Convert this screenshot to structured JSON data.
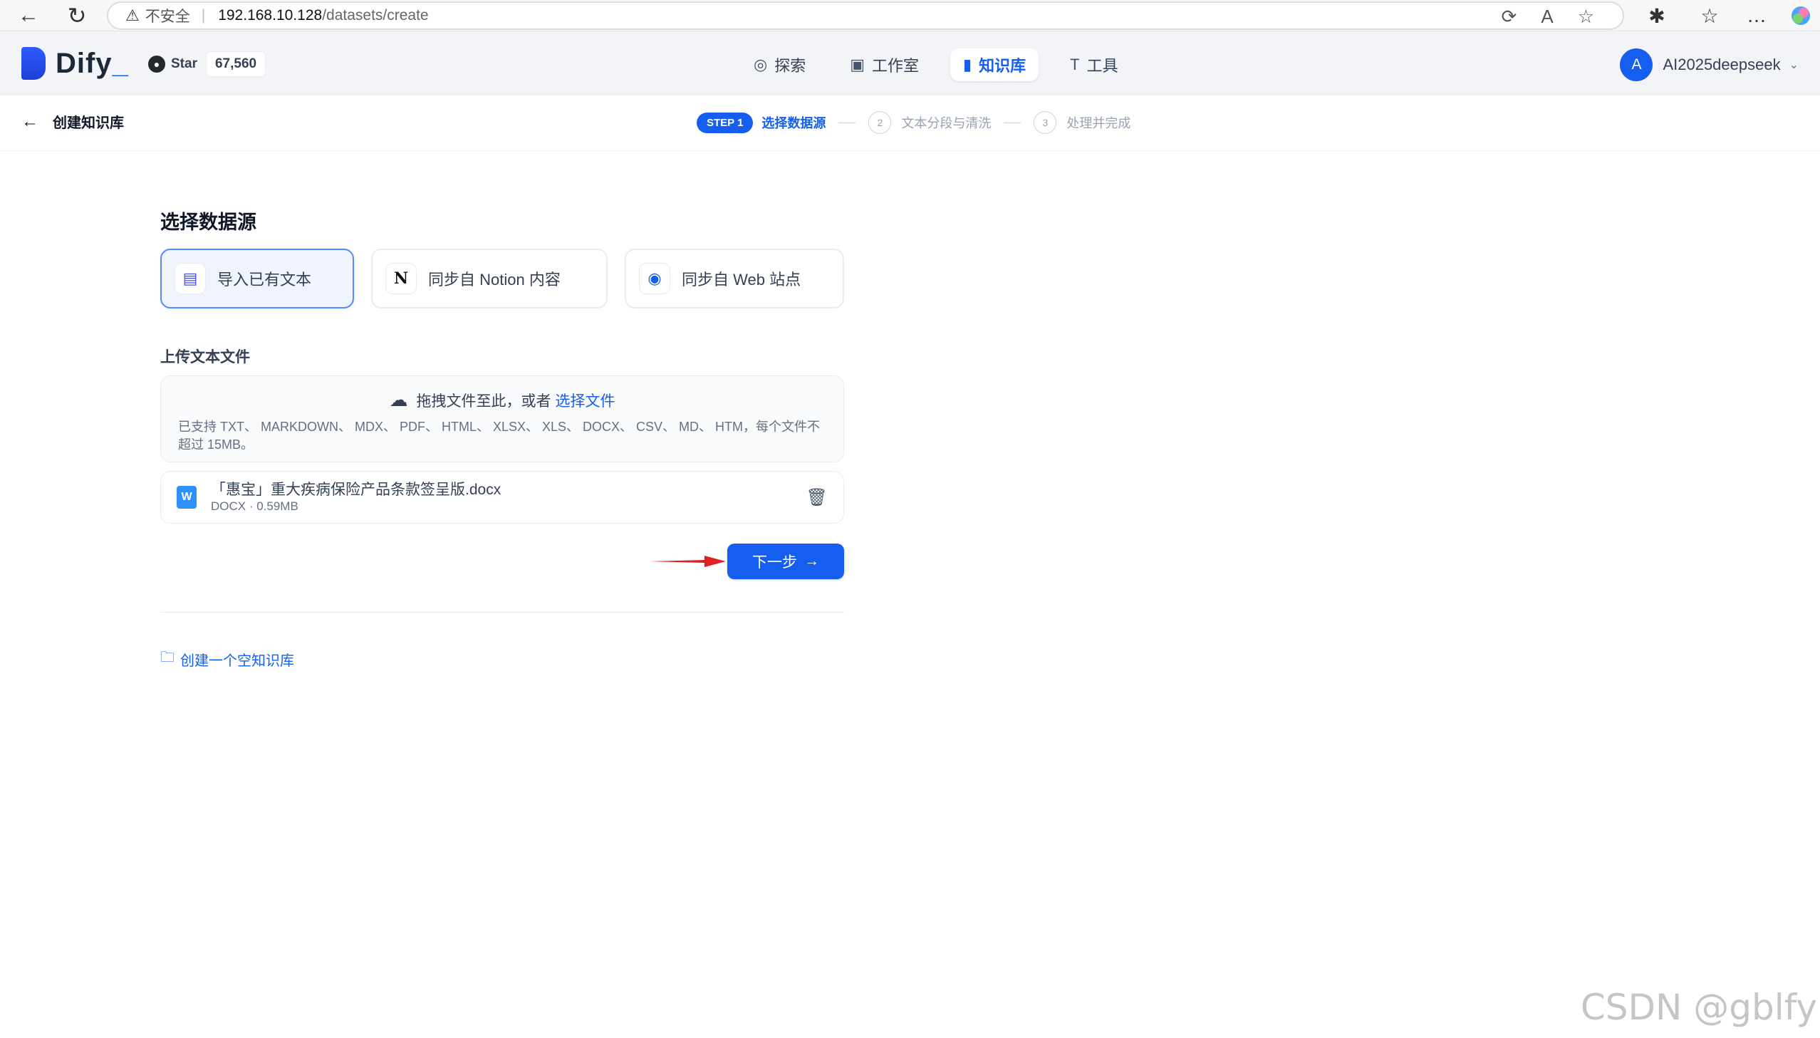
{
  "browser": {
    "back_icon": "←",
    "reload_icon": "↻",
    "security_warning": "不安全",
    "url_host": "192.168.10.128",
    "url_path": "/datasets/create"
  },
  "header": {
    "logo_text": "Dify",
    "logo_dot": "_",
    "star_label": "Star",
    "star_count": "67,560",
    "nav": [
      {
        "label": "探索",
        "icon": "explore-icon"
      },
      {
        "label": "工作室",
        "icon": "robot-icon"
      },
      {
        "label": "知识库",
        "icon": "book-icon"
      },
      {
        "label": "工具",
        "icon": "hammer-icon"
      }
    ],
    "active_nav": "知识库",
    "user_initial": "A",
    "user_name": "AI2025deepseek"
  },
  "subheader": {
    "title": "创建知识库",
    "steps": [
      {
        "badge": "STEP 1",
        "label": "选择数据源"
      },
      {
        "badge": "2",
        "label": "文本分段与清洗"
      },
      {
        "badge": "3",
        "label": "处理并完成"
      }
    ]
  },
  "main": {
    "section_title": "选择数据源",
    "sources": [
      {
        "label": "导入已有文本",
        "icon": "file-icon"
      },
      {
        "label": "同步自 Notion 内容",
        "icon": "notion-icon"
      },
      {
        "label": "同步自 Web 站点",
        "icon": "globe-icon"
      }
    ],
    "upload_title": "上传文本文件",
    "drop_text": "拖拽文件至此，或者",
    "drop_link": "选择文件",
    "drop_hint": "已支持 TXT、 MARKDOWN、 MDX、 PDF、 HTML、 XLSX、 XLS、 DOCX、 CSV、 MD、 HTM，每个文件不超过 15MB。",
    "file": {
      "name": "「惠宝」重大疾病保险产品条款签呈版.docx",
      "meta": "DOCX · 0.59MB"
    },
    "next_label": "下一步",
    "empty_link": "创建一个空知识库"
  },
  "watermark": "CSDN @gblfy",
  "colors": {
    "primary": "#155eef",
    "annotation_arrow": "#e02020"
  }
}
